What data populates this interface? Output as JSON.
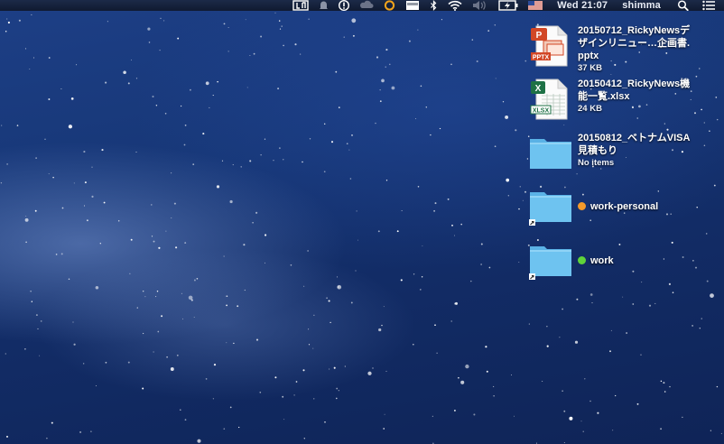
{
  "menubar": {
    "clock": "Wed 21:07",
    "user": "shimma",
    "status_icons": [
      "menu-app-icon",
      "notification-bell-icon",
      "info-circle-icon",
      "cloud-icon",
      "sync-ring-icon",
      "keyboard-icon",
      "bluetooth-icon",
      "wifi-icon",
      "volume-icon",
      "battery-charging-icon",
      "us-flag-icon"
    ],
    "right_icons": [
      "spotlight-search-icon",
      "notification-center-icon"
    ]
  },
  "desktop": {
    "items": [
      {
        "name": "20150712_RickyNewsデザインリニュー…企画書.pptx",
        "sub": "37 KB",
        "kind": "pptx",
        "badge": "PPTX",
        "badge_color": "#d24726"
      },
      {
        "name": "20150412_RickyNews機能一覧.xlsx",
        "sub": "24 KB",
        "kind": "xlsx",
        "badge": "XLSX",
        "badge_color": "#1e7145"
      },
      {
        "name": "20150812_ベトナムVISA見積もり",
        "sub": "No items",
        "kind": "folder"
      },
      {
        "name": "work-personal",
        "sub": "",
        "kind": "folder-alias",
        "tag_color": "#f39a2b"
      },
      {
        "name": "work",
        "sub": "",
        "kind": "folder-alias",
        "tag_color": "#5fd33a"
      }
    ]
  },
  "colors": {
    "folder": "#6ec3f0",
    "folder_tab": "#5ab2e6",
    "menubar": "#141f38",
    "wallpaper": "#173777"
  }
}
